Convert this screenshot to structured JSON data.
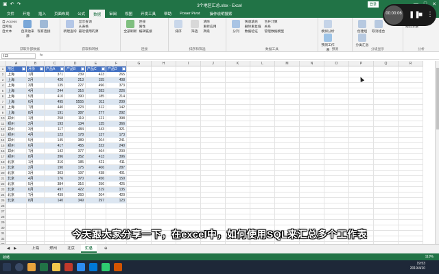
{
  "window": {
    "title": "3个地区汇总.xlsx - Excel",
    "sign_in": "登录"
  },
  "tabs": [
    "文件",
    "开始",
    "插入",
    "页面布局",
    "公式",
    "数据",
    "审阅",
    "视图",
    "开发工具",
    "帮助",
    "Power Pivot"
  ],
  "tell_me": "操作说明搜索",
  "ribbon": {
    "g1": {
      "items": [
        "自 Access",
        "自网站",
        "自文本",
        "自其他来源",
        "现有连接"
      ],
      "name": "获取外部数据"
    },
    "g2": {
      "items": [
        "新建查询",
        "显示查询",
        "从表格",
        "最近使用的源"
      ],
      "name": "获取和转换"
    },
    "g3": {
      "items": [
        "全部刷新",
        "连接",
        "属性",
        "编辑链接"
      ],
      "name": "连接"
    },
    "g4": {
      "items": [
        "排序",
        "筛选",
        "清除",
        "重新应用",
        "高级"
      ],
      "name": "排序和筛选"
    },
    "g5": {
      "items": [
        "分列",
        "快速填充",
        "删除重复值",
        "数据验证",
        "合并计算",
        "关系",
        "管理数据模型"
      ],
      "name": "数据工具"
    },
    "g6": {
      "items": [
        "模拟分析",
        "预测工作表"
      ],
      "name": "预测"
    },
    "g7": {
      "items": [
        "创建组",
        "取消组合",
        "分类汇总"
      ],
      "name": "分级显示"
    },
    "g8": {
      "items": [
        "数据分析",
        "规划求解"
      ],
      "name": "分析"
    }
  },
  "formula_bar": {
    "name_box": "I13",
    "fx": "fx"
  },
  "columns": [
    "A",
    "B",
    "C",
    "D",
    "E",
    "F",
    "G",
    "H",
    "I",
    "J",
    "K",
    "L",
    "M",
    "N",
    "O",
    "P",
    "Q",
    "R"
  ],
  "table": {
    "headers": [
      "地区",
      "月份",
      "产品A",
      "产品B",
      "产品C",
      "产品D"
    ],
    "rows": [
      [
        "上海",
        "1月",
        "371",
        "239",
        "423",
        "265"
      ],
      [
        "上海",
        "2月",
        "420",
        "213",
        "155",
        "408"
      ],
      [
        "上海",
        "3月",
        "135",
        "227",
        "496",
        "373"
      ],
      [
        "上海",
        "4月",
        "244",
        "316",
        "283",
        "226"
      ],
      [
        "上海",
        "5月",
        "410",
        "390",
        "185",
        "214"
      ],
      [
        "上海",
        "6月",
        "495",
        "5555",
        "311",
        "209"
      ],
      [
        "上海",
        "7月",
        "440",
        "223",
        "312",
        "142"
      ],
      [
        "上海",
        "8月",
        "191",
        "387",
        "277",
        "292"
      ],
      [
        "郑州",
        "1月",
        "258",
        "119",
        "121",
        "398"
      ],
      [
        "郑州",
        "2月",
        "193",
        "134",
        "135",
        "366"
      ],
      [
        "郑州",
        "3月",
        "117",
        "484",
        "343",
        "321"
      ],
      [
        "郑州",
        "4月",
        "123",
        "178",
        "137",
        "173"
      ],
      [
        "郑州",
        "5月",
        "145",
        "389",
        "204",
        "241"
      ],
      [
        "郑州",
        "6月",
        "417",
        "455",
        "322",
        "240"
      ],
      [
        "郑州",
        "7月",
        "142",
        "377",
        "464",
        "200"
      ],
      [
        "郑州",
        "8月",
        "396",
        "352",
        "413",
        "396"
      ],
      [
        "北京",
        "1月",
        "316",
        "185",
        "421",
        "411"
      ],
      [
        "北京",
        "2月",
        "190",
        "175",
        "406",
        "287"
      ],
      [
        "北京",
        "3月",
        "303",
        "197",
        "438",
        "401"
      ],
      [
        "北京",
        "4月",
        "176",
        "370",
        "456",
        "159"
      ],
      [
        "北京",
        "5月",
        "384",
        "316",
        "256",
        "425"
      ],
      [
        "北京",
        "6月",
        "497",
        "422",
        "319",
        "135"
      ],
      [
        "北京",
        "7月",
        "439",
        "260",
        "204",
        "420"
      ],
      [
        "北京",
        "8月",
        "140",
        "349",
        "297",
        "123"
      ]
    ]
  },
  "row_numbers": [
    "1",
    "2",
    "3",
    "4",
    "5",
    "6",
    "7",
    "8",
    "9",
    "10",
    "11",
    "12",
    "13",
    "14",
    "15",
    "16",
    "17",
    "18",
    "19",
    "20",
    "21",
    "22",
    "23",
    "24",
    "25",
    "26",
    "27",
    "28",
    "29",
    "30",
    "31",
    "32",
    "33"
  ],
  "sheet_tabs": [
    "上海",
    "郑州",
    "北京",
    "汇总"
  ],
  "active_sheet": "汇总",
  "status": {
    "left": "就绪",
    "zoom": "110%"
  },
  "subtitle": "今天跟大家分享一下，在excel中，如何使用SQL来汇总多个工作表",
  "recorder": {
    "time": "00:00:06"
  },
  "clock": {
    "time": "19:53",
    "date": "2019/4/10"
  },
  "colors": {
    "excel_green": "#217346",
    "table_header": "#4472c4",
    "band": "#dce6f1"
  }
}
